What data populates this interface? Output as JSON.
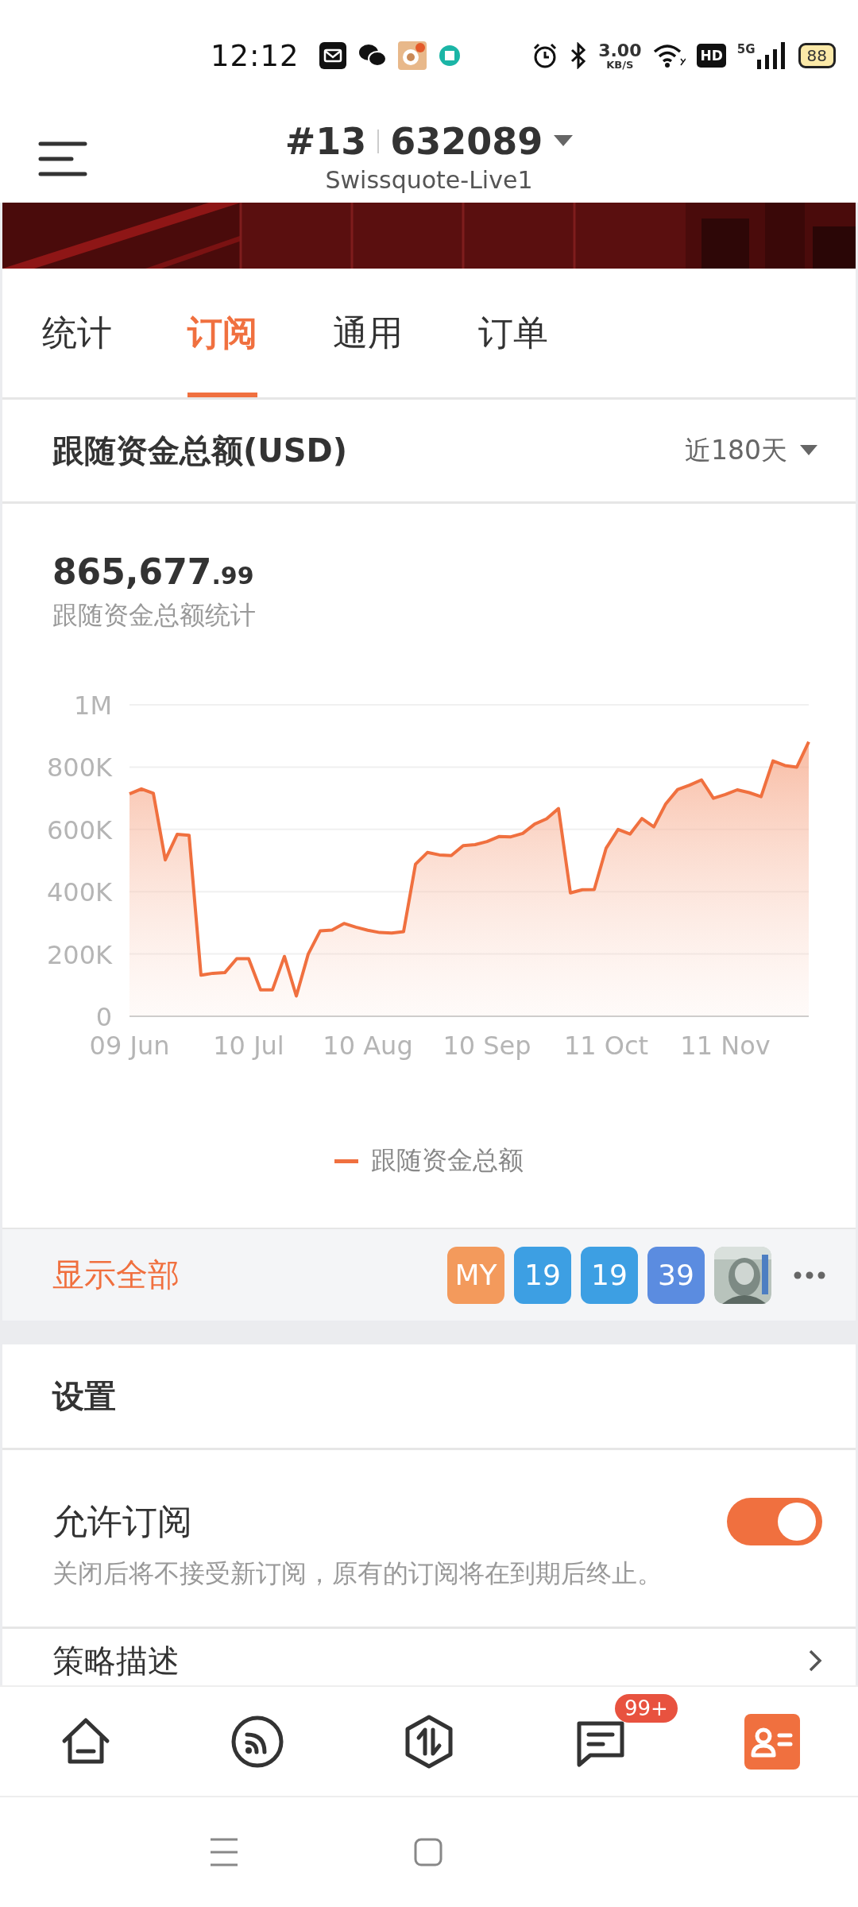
{
  "status_bar": {
    "time": "12:12",
    "net_speed": "3.00",
    "net_speed_unit": "KB/S",
    "hd": "HD",
    "network": "5G",
    "battery": "88"
  },
  "header": {
    "account": "#13",
    "number": "632089",
    "server": "Swissquote-Live1"
  },
  "banner": {
    "kind": "picture"
  },
  "tabs": [
    {
      "label": "统计",
      "selected": false
    },
    {
      "label": "订阅",
      "selected": true
    },
    {
      "label": "通用",
      "selected": false
    },
    {
      "label": "订单",
      "selected": false
    }
  ],
  "fund_section": {
    "title": "跟随资金总额(USD)",
    "period": "近180天",
    "total_main": "865,677",
    "total_decimal": ".99",
    "total_label": "跟随资金总额统计",
    "chart_data": {
      "type": "area",
      "grid": true,
      "categories": [
        "09 Jun",
        null,
        null,
        null,
        null,
        null,
        null,
        null,
        null,
        null,
        "10 Jul",
        null,
        null,
        null,
        null,
        null,
        null,
        null,
        null,
        null,
        "10 Aug",
        null,
        null,
        null,
        null,
        null,
        null,
        null,
        null,
        null,
        "10 Sep",
        null,
        null,
        null,
        null,
        null,
        null,
        null,
        null,
        null,
        "11 Oct",
        null,
        null,
        null,
        null,
        null,
        null,
        null,
        null,
        null,
        "11 Nov",
        null,
        null,
        null,
        null,
        null,
        null,
        null
      ],
      "series": [
        {
          "name": "跟随资金总额",
          "color": "#f0703f",
          "values": [
            714000,
            730000,
            716000,
            502000,
            584000,
            581000,
            132000,
            138000,
            140000,
            185000,
            185000,
            85000,
            85000,
            192000,
            65000,
            200000,
            274000,
            277000,
            298000,
            286000,
            276000,
            269000,
            267000,
            272000,
            488000,
            526000,
            518000,
            516000,
            548000,
            551000,
            561000,
            577000,
            576000,
            587000,
            617000,
            634000,
            667000,
            396000,
            406000,
            407000,
            540000,
            600000,
            585000,
            635000,
            608000,
            682000,
            728000,
            742000,
            759000,
            700000,
            712000,
            727000,
            718000,
            705000,
            820000,
            805000,
            800000,
            881000
          ]
        }
      ],
      "ylim": [
        0,
        1000000
      ],
      "yticks": [
        {
          "value": 0,
          "label": "0"
        },
        {
          "value": 200000,
          "label": "200K"
        },
        {
          "value": 400000,
          "label": "400K"
        },
        {
          "value": 600000,
          "label": "600K"
        },
        {
          "value": 800000,
          "label": "800K"
        },
        {
          "value": 1000000,
          "label": "1M"
        }
      ]
    }
  },
  "subscribers": {
    "show_all": "显示全部",
    "items": [
      {
        "kind": "text",
        "label": "MY",
        "color": "#f39a5c"
      },
      {
        "kind": "text",
        "label": "19",
        "color": "#3d9fe3"
      },
      {
        "kind": "text",
        "label": "19",
        "color": "#3d9fe3"
      },
      {
        "kind": "text",
        "label": "39",
        "color": "#5b8ce0"
      },
      {
        "kind": "picture"
      }
    ]
  },
  "settings": {
    "title": "设置",
    "rows": [
      {
        "kind": "toggle",
        "label": "允许订阅",
        "description": "关闭后将不接受新订阅，原有的订阅将在到期后终止。",
        "on": true
      },
      {
        "kind": "link",
        "label": "策略描述"
      }
    ]
  },
  "bottom_nav": [
    {
      "kind": "home",
      "selected": false
    },
    {
      "kind": "feed",
      "selected": false
    },
    {
      "kind": "trade",
      "selected": false
    },
    {
      "kind": "messages",
      "selected": false,
      "badge": "99+"
    },
    {
      "kind": "profile",
      "selected": true
    }
  ]
}
